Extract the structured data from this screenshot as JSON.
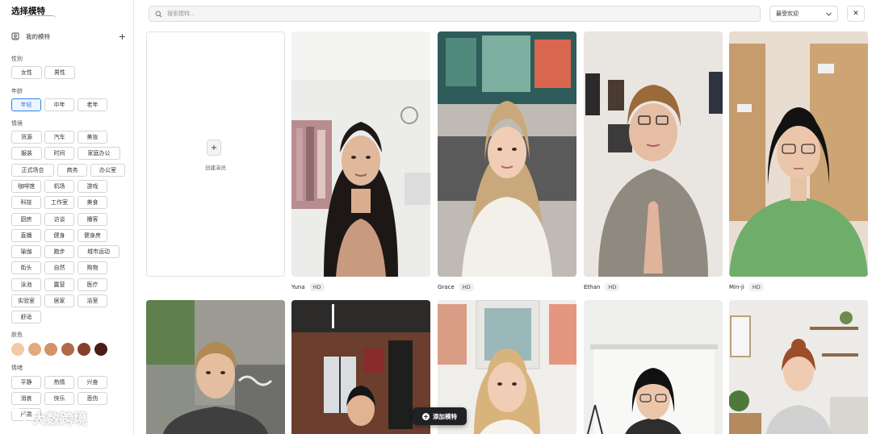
{
  "sidebar": {
    "title": "选择模特",
    "my_models": "我的模特",
    "sections": {
      "gender": {
        "label": "性别",
        "options": [
          "女性",
          "男性"
        ]
      },
      "age": {
        "label": "年龄",
        "options": [
          "年轻",
          "中年",
          "老年"
        ],
        "selected": "年轻"
      },
      "scene": {
        "label": "情境",
        "options": [
          "货源",
          "汽车",
          "美妆",
          "服装",
          "时间",
          "家庭办公",
          "正式场合",
          "商务",
          "办公室",
          "咖啡馆",
          "机场",
          "游戏",
          "科技",
          "工作室",
          "美食",
          "厨房",
          "访谈",
          "播客",
          "直播",
          "健身",
          "健身房",
          "瑜伽",
          "跑步",
          "城市运动",
          "街头",
          "自然",
          "购物",
          "泳池",
          "露营",
          "医疗",
          "实验室",
          "居家",
          "浴室",
          "舒适"
        ]
      },
      "skin": {
        "label": "肤色",
        "colors": [
          "#f1c9a5",
          "#e3aa7e",
          "#cf9467",
          "#b2694a",
          "#8a3f2c",
          "#4b1c17"
        ]
      },
      "mood": {
        "label": "情绪",
        "options": [
          "平静",
          "热情",
          "兴奋",
          "消哀",
          "快乐",
          "悲伤",
          "严肃"
        ]
      }
    }
  },
  "search": {
    "placeholder": "搜索模特..."
  },
  "sort": {
    "value": "最受欢迎"
  },
  "create_card": {
    "label": "创建演员"
  },
  "models": [
    {
      "name": "Yuna",
      "badge": "HD"
    },
    {
      "name": "Grace",
      "badge": "HD"
    },
    {
      "name": "Ethan",
      "badge": "HD"
    },
    {
      "name": "Min-ji",
      "badge": "HD"
    }
  ],
  "add_button": {
    "label": "添加模特"
  },
  "watermark": {
    "text": "大数跨境"
  }
}
